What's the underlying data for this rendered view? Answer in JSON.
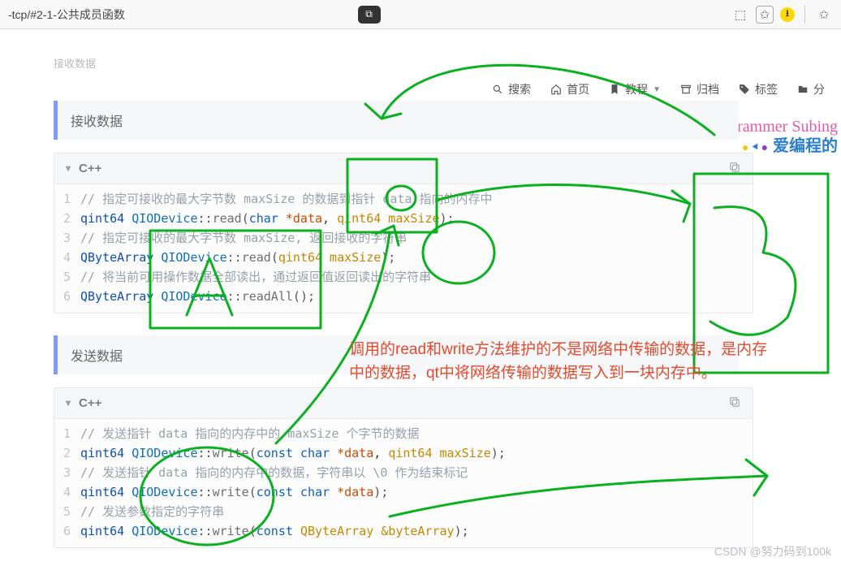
{
  "browser": {
    "url_fragment": "-tcp/#2-1-公共成员函数",
    "icons": {
      "pip": "⧉",
      "reader": "⬚",
      "fav": "✩",
      "idm": "⭳",
      "extra_fav": "✩"
    }
  },
  "breadcrumb": "接收数据",
  "nav": {
    "search": {
      "label": "搜索",
      "icon": "search-icon"
    },
    "home": {
      "label": "首页",
      "icon": "home-icon"
    },
    "tutorial": {
      "label": "教程",
      "icon": "bookmark-icon"
    },
    "archive": {
      "label": "归档",
      "icon": "archive-icon"
    },
    "tags": {
      "label": "标签",
      "icon": "tag-icon"
    },
    "category": {
      "label": "分",
      "icon": "folder-icon"
    }
  },
  "brand": {
    "script": "Programmer Subing",
    "cn": "爱编程的"
  },
  "sections": {
    "recv_title": "接收数据",
    "send_title": "发送数据"
  },
  "code": {
    "lang": "C++",
    "recv": [
      {
        "n": "1",
        "kind": "comment",
        "text": "// 指定可接收的最大字节数 maxSize 的数据到指针 data 指向的内存中"
      },
      {
        "n": "2",
        "kind": "sig",
        "type": "qint64",
        "ns": "QIODevice",
        "fn": "read",
        "args_html": "<span class='c-kw'>char</span> <span class='c-ptr'>*data</span>, <span class='c-arg'>qint64 maxSize</span>"
      },
      {
        "n": "3",
        "kind": "comment",
        "text": "// 指定可接收的最大字节数 maxSize, 返回接收的字符串"
      },
      {
        "n": "4",
        "kind": "sig",
        "type": "QByteArray",
        "ns": "QIODevice",
        "fn": "read",
        "args_html": "<span class='c-arg'>qint64 maxSize</span>"
      },
      {
        "n": "5",
        "kind": "comment",
        "text": "// 将当前可用操作数据全部读出，通过返回值返回读出的字符串"
      },
      {
        "n": "6",
        "kind": "sig",
        "type": "QByteArray",
        "ns": "QIODevice",
        "fn": "readAll",
        "args_html": ""
      }
    ],
    "send": [
      {
        "n": "1",
        "kind": "comment",
        "text": "// 发送指针 data 指向的内存中的 maxSize 个字节的数据"
      },
      {
        "n": "2",
        "kind": "sig",
        "type": "qint64",
        "ns": "QIODevice",
        "fn": "write",
        "args_html": "<span class='c-kw'>const char</span> <span class='c-ptr'>*data</span>, <span class='c-arg'>qint64 maxSize</span>"
      },
      {
        "n": "3",
        "kind": "comment",
        "text": "// 发送指针 data 指向的内存中的数据，字符串以 \\0 作为结束标记"
      },
      {
        "n": "4",
        "kind": "sig",
        "type": "qint64",
        "ns": "QIODevice",
        "fn": "write",
        "args_html": "<span class='c-kw'>const char</span> <span class='c-ptr'>*data</span>"
      },
      {
        "n": "5",
        "kind": "comment",
        "text": "// 发送参数指定的字符串"
      },
      {
        "n": "6",
        "kind": "sig",
        "type": "qint64",
        "ns": "QIODevice",
        "fn": "write",
        "args_html": "<span class='c-kw'>const</span> <span class='c-arg'>QByteArray &amp;byteArray</span>"
      }
    ]
  },
  "annotation_text": "调用的read和write方法维护的不是网络中传输的数据，是内存中的数据，qt中将网络传输的数据写入到一块内存中。",
  "watermark": "CSDN @努力码到100k"
}
